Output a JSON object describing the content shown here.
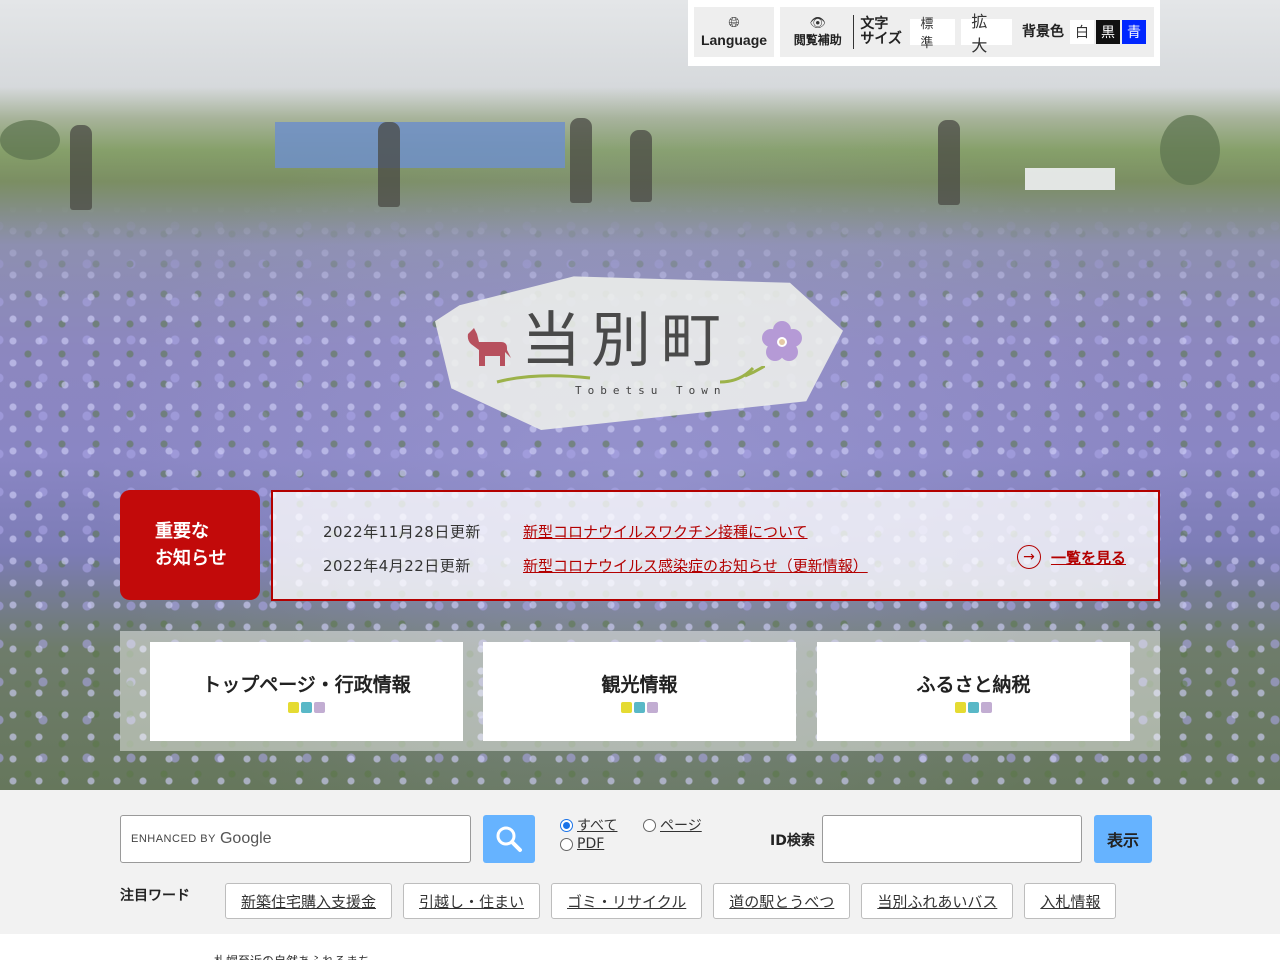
{
  "utility": {
    "language_label": "Language",
    "language_icon": "globe-icon",
    "assist_label": "閲覧補助",
    "assist_icon": "eye-icon",
    "font_size_label": "文字\nサイズ",
    "font_size_options": [
      "標準",
      "拡大"
    ],
    "bg_color_label": "背景色",
    "bg_colors": [
      {
        "label": "白",
        "color": "#ffffff"
      },
      {
        "label": "黒",
        "color": "#111111"
      },
      {
        "label": "青",
        "color": "#0026ff"
      }
    ]
  },
  "logo": {
    "title": "当別町",
    "subtitle": "Tobetsu Town"
  },
  "notice": {
    "heading": "重要な\nお知らせ",
    "items": [
      {
        "date": "2022年11月28日更新",
        "title": "新型コロナウイルスワクチン接種について"
      },
      {
        "date": "2022年4月22日更新",
        "title": "新型コロナウイルス感染症のお知らせ（更新情報）"
      }
    ],
    "see_all": "一覧を見る"
  },
  "main_nav": [
    {
      "label": "トップページ・行政情報"
    },
    {
      "label": "観光情報"
    },
    {
      "label": "ふるさと納税"
    }
  ],
  "search": {
    "brand_prefix": "ENHANCED BY",
    "brand_name": "Google",
    "button_icon": "search-icon",
    "scope_options": [
      {
        "label": "すべて",
        "selected": true
      },
      {
        "label": "ページ",
        "selected": false
      },
      {
        "label": "PDF",
        "selected": false
      }
    ],
    "id_search_label": "ID検索",
    "id_search_value": "",
    "show_button": "表示"
  },
  "keywords": {
    "label": "注目ワード",
    "items": [
      "新築住宅購入支援金",
      "引越し・住まい",
      "ゴミ・リサイクル",
      "道の駅とうべつ",
      "当別ふれあいバス",
      "入札情報"
    ]
  },
  "footer_peek": {
    "text": "札幌至近の自然あふれるまち"
  },
  "colors": {
    "accent_red": "#c20a0a",
    "accent_blue": "#66b3ff",
    "dot_yellow": "#e5db32",
    "dot_teal": "#59b8c7",
    "dot_purple": "#c2add2"
  }
}
